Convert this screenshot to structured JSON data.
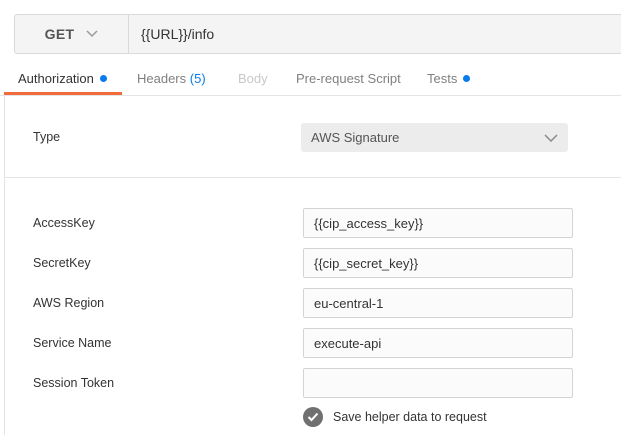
{
  "request": {
    "method": "GET",
    "url": "{{URL}}/info"
  },
  "tabs": [
    {
      "label": "Authorization",
      "dot": true
    },
    {
      "label": "Headers",
      "count": "(5)"
    },
    {
      "label": "Body"
    },
    {
      "label": "Pre-request Script"
    },
    {
      "label": "Tests",
      "dot": true
    }
  ],
  "auth": {
    "type_label": "Type",
    "type_value": "AWS Signature",
    "fields": [
      {
        "label": "AccessKey",
        "value": "{{cip_access_key}}"
      },
      {
        "label": "SecretKey",
        "value": "{{cip_secret_key}}"
      },
      {
        "label": "AWS Region",
        "value": "eu-central-1"
      },
      {
        "label": "Service Name",
        "value": "execute-api"
      },
      {
        "label": "Session Token",
        "value": ""
      }
    ],
    "helper_label": "Save helper data to request",
    "helper_checked": true
  },
  "colors": {
    "accent": "#f26b3a",
    "dot": "#097bed"
  }
}
